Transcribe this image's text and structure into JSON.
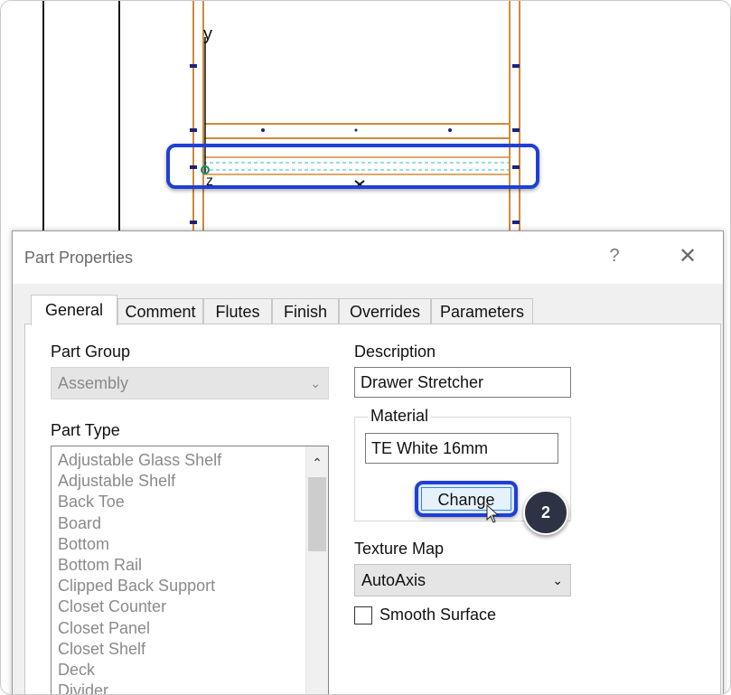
{
  "cad_view": {
    "axis_y": "y",
    "axis_z": "z",
    "axis_x": "x"
  },
  "dialog": {
    "title": "Part Properties",
    "help_label": "?",
    "close_label": "✕",
    "tabs": [
      "General",
      "Comment",
      "Flutes",
      "Finish",
      "Overrides",
      "Parameters"
    ],
    "active_tab": "General"
  },
  "general": {
    "part_group_label": "Part Group",
    "part_group_value": "Assembly",
    "part_type_label": "Part Type",
    "part_types": [
      "Adjustable Glass Shelf",
      "Adjustable Shelf",
      "Back Toe",
      "Board",
      "Bottom",
      "Bottom Rail",
      "Clipped Back Support",
      "Closet Counter",
      "Closet Panel",
      "Closet Shelf",
      "Deck",
      "Divider"
    ],
    "description_label": "Description",
    "description_value": "Drawer Stretcher",
    "material_label": "Material",
    "material_value": "TE White 16mm",
    "change_button": "Change",
    "texture_map_label": "Texture Map",
    "texture_map_value": "AutoAxis",
    "smooth_surface_label": "Smooth Surface",
    "smooth_surface_checked": false
  },
  "annotation": {
    "step_number": "2",
    "highlight_color": "#1f3fd6"
  }
}
